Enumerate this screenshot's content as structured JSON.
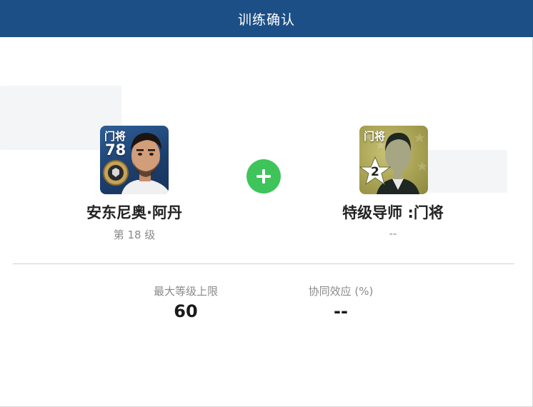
{
  "header": {
    "title": "训练确认"
  },
  "player": {
    "position": "门将",
    "rating": "78",
    "name": "安东尼奥·阿丹",
    "level_text": "第 18 级"
  },
  "coach": {
    "position": "门将",
    "star_number": "2",
    "name": "特级导师 :门将",
    "level_text": "--"
  },
  "stats": {
    "max_level_label": "最大等级上限",
    "max_level_value": "60",
    "synergy_label": "协同效应 (%)",
    "synergy_value": "--"
  },
  "colors": {
    "header_bg": "#1c4f86",
    "plus_button": "#3ec45a",
    "coach_card": "#a59f52"
  },
  "icons": {
    "plus": "plus-icon",
    "player_photo": "player-portrait-icon",
    "coach_silhouette": "coach-silhouette-icon",
    "badge": "club-badge-icon",
    "star": "star-icon"
  }
}
